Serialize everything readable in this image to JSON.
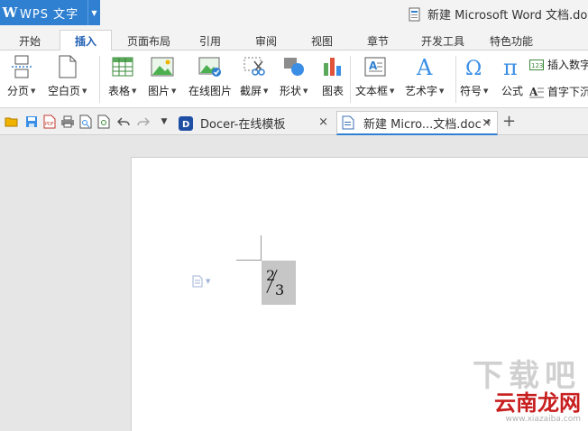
{
  "app": {
    "name": "WPS 文字",
    "logo": "W",
    "doc_title": "新建 Microsoft Word 文档.doc"
  },
  "menu": {
    "tabs": [
      {
        "label": "开始"
      },
      {
        "label": "插入"
      },
      {
        "label": "页面布局"
      },
      {
        "label": "引用"
      },
      {
        "label": "审阅"
      },
      {
        "label": "视图"
      },
      {
        "label": "章节"
      },
      {
        "label": "开发工具"
      },
      {
        "label": "特色功能"
      }
    ],
    "active": "插入"
  },
  "ribbon": {
    "page_break": "分页",
    "blank_page": "空白页",
    "table": "表格",
    "picture": "图片",
    "online_picture": "在线图片",
    "screenshot": "截屏",
    "shape": "形状",
    "chart": "图表",
    "textbox": "文本框",
    "wordart": "艺术字",
    "symbol": "符号",
    "formula": "公式",
    "insert_number": "插入数字",
    "dropcap": "首字下沉"
  },
  "doctabs": [
    {
      "label": "Docer-在线模板",
      "close": "×"
    },
    {
      "label": "新建 Micro...文档.doc *",
      "close": "×"
    }
  ],
  "newtab": "+",
  "document": {
    "numerator": "2",
    "denominator": "3"
  },
  "watermark": {
    "big": "下载吧",
    "cn": "云南龙网",
    "url": "www.xiazaiba.com"
  },
  "colors": {
    "accent": "#2f80d1",
    "selection": "#c6c6c6"
  }
}
